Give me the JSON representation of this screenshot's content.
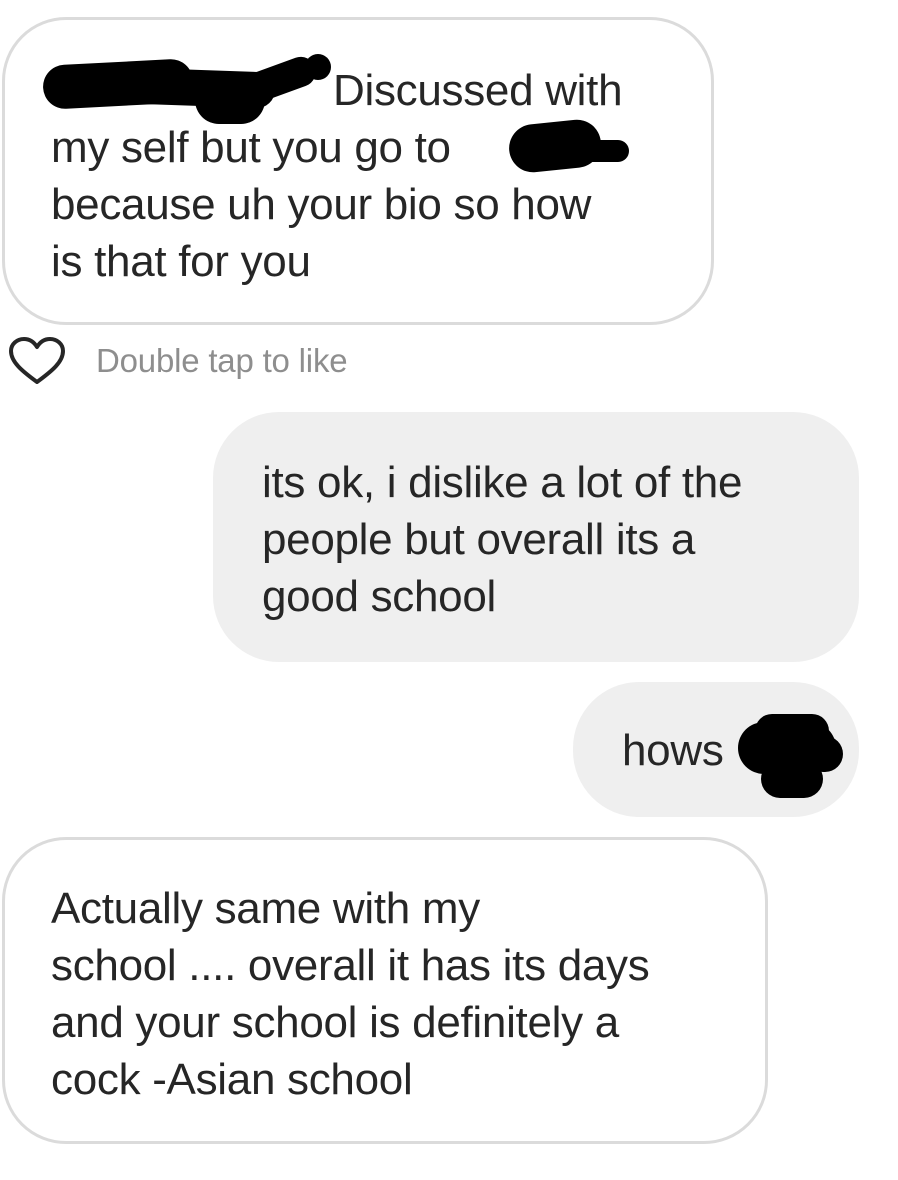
{
  "messages": [
    {
      "direction": "incoming",
      "lines": "Discussed with\nmy self but you go to\nbecause uh your bio so how\nis that for you",
      "redacted": true
    },
    {
      "direction": "outgoing",
      "lines": "its ok, i dislike a lot of the\npeople but overall its a\ngood school"
    },
    {
      "direction": "outgoing",
      "lines": "hows",
      "redacted": true
    },
    {
      "direction": "incoming",
      "lines": "Actually same with my\nschool .... overall it has its days\nand your school is definitely a\ncock -Asian school"
    }
  ],
  "like_hint": {
    "icon": "heart-outline-icon",
    "label": "Double tap to like"
  },
  "colors": {
    "incoming_bubble_bg": "#ffffff",
    "incoming_bubble_border": "#dbdbdb",
    "outgoing_bubble_bg": "#efefef",
    "text": "#262626",
    "hint_text": "#8e8e8e",
    "redaction": "#000000"
  }
}
